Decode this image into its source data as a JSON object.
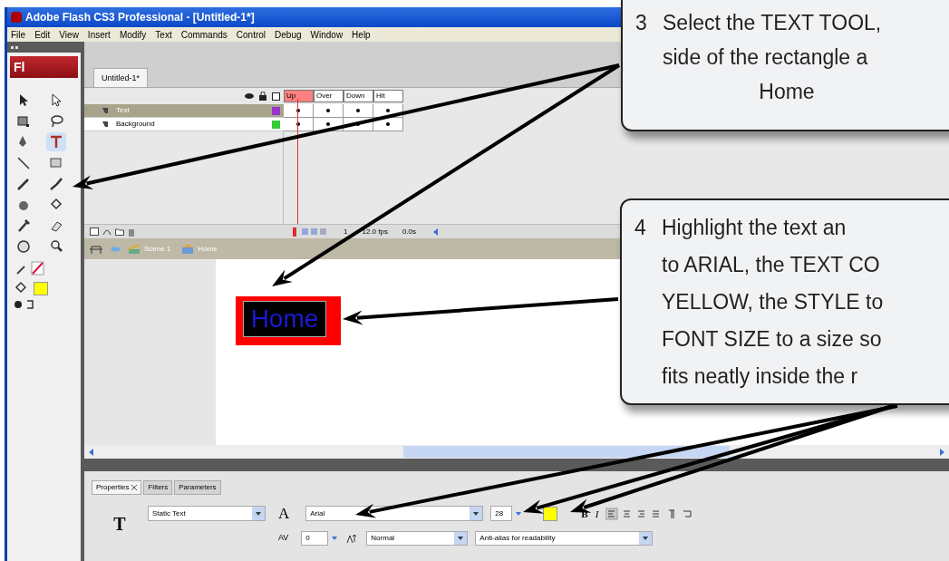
{
  "window": {
    "title": "Adobe Flash CS3 Professional - [Untitled-1*]"
  },
  "menu": [
    "File",
    "Edit",
    "View",
    "Insert",
    "Modify",
    "Text",
    "Commands",
    "Control",
    "Debug",
    "Window",
    "Help"
  ],
  "toolbox": {
    "logo": "Fl",
    "tools": [
      {
        "kind": "selection",
        "selected": false
      },
      {
        "kind": "subselection",
        "selected": false
      },
      {
        "kind": "transform",
        "selected": false
      },
      {
        "kind": "lasso",
        "selected": false
      },
      {
        "kind": "pen",
        "selected": false
      },
      {
        "kind": "text",
        "selected": true
      },
      {
        "kind": "line",
        "selected": false
      },
      {
        "kind": "rectangle",
        "selected": false
      },
      {
        "kind": "pencil",
        "selected": false
      },
      {
        "kind": "brush",
        "selected": false
      },
      {
        "kind": "ink",
        "selected": false
      },
      {
        "kind": "bucket",
        "selected": false
      },
      {
        "kind": "eyedropper",
        "selected": false
      },
      {
        "kind": "eraser",
        "selected": false
      },
      {
        "kind": "hand",
        "selected": false
      },
      {
        "kind": "zoom",
        "selected": false
      }
    ]
  },
  "document_tab": "Untitled-1*",
  "timeline": {
    "frames": [
      {
        "label": "Up",
        "selected": true
      },
      {
        "label": "Over",
        "selected": false
      },
      {
        "label": "Down",
        "selected": false
      },
      {
        "label": "Hit",
        "selected": false
      }
    ],
    "layers": [
      {
        "name": "Text",
        "selected": true,
        "color": "#9933cc"
      },
      {
        "name": "Background",
        "selected": false,
        "color": "#33cc33"
      }
    ],
    "current_frame": "1",
    "frame_rate": "12.0 fps",
    "elapsed": "0.0s"
  },
  "edit_bar": [
    "Scene 1",
    "Home"
  ],
  "stage": {
    "button_text": "Home"
  },
  "properties": {
    "tabs": [
      {
        "label": "Properties",
        "selected": true
      },
      {
        "label": "Filters",
        "selected": false
      },
      {
        "label": "Parameters",
        "selected": false
      }
    ],
    "type_glyph": "T",
    "font_glyph": "A",
    "bold_glyph": "B",
    "italic_glyph": "I",
    "spacing_glyph": "AV",
    "text_type": "Static Text",
    "font": "Arial",
    "font_size": "28",
    "letter_spacing": "0",
    "position": "Normal",
    "anti_alias": "Anti-alias for readability"
  },
  "callouts": [
    {
      "number": "3",
      "lines": [
        "Select the TEXT TOOL,",
        "side of the rectangle a"
      ],
      "example": "Home"
    },
    {
      "number": "4",
      "lines": [
        "Highlight the text an",
        "to ARIAL, the TEXT CO",
        "YELLOW, the STYLE to",
        "FONT SIZE to a size so",
        "fits neatly inside the r"
      ]
    }
  ]
}
